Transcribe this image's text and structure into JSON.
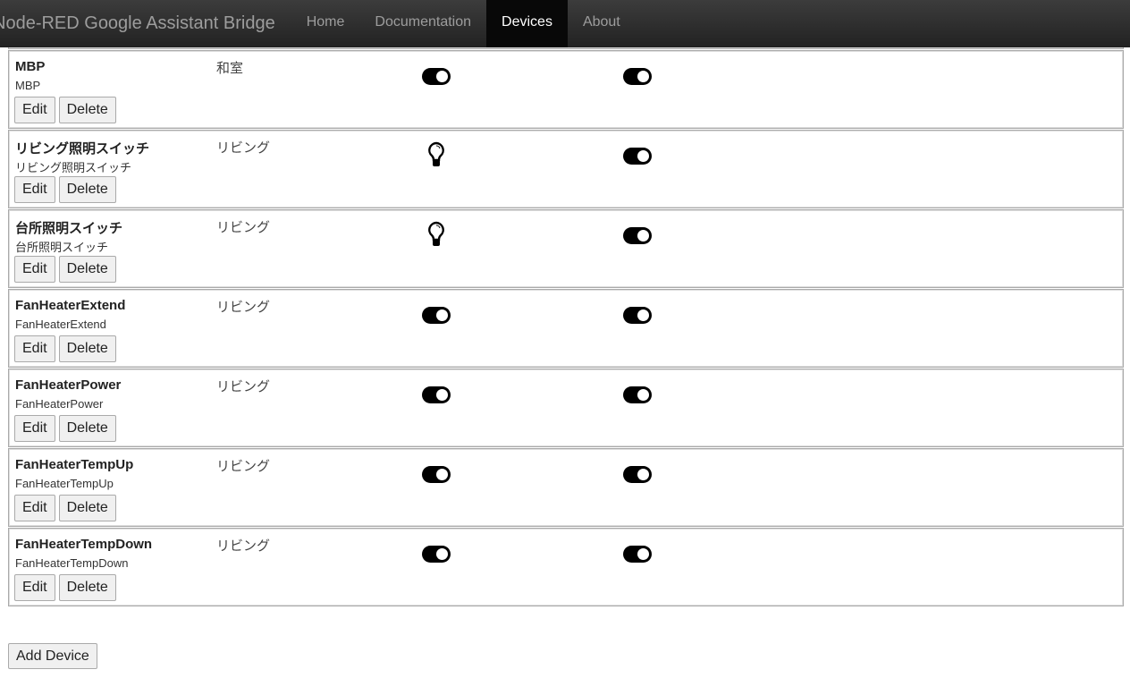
{
  "nav": {
    "brand": "Node-RED Google Assistant Bridge",
    "links": [
      "Home",
      "Documentation",
      "Devices",
      "About"
    ],
    "active": "Devices"
  },
  "buttons": {
    "edit": "Edit",
    "delete": "Delete",
    "add": "Add Device"
  },
  "devices": [
    {
      "name": "",
      "id": "",
      "room": "",
      "col1": "",
      "col2": ""
    },
    {
      "name": "MBP",
      "id": "MBP",
      "room": "和室",
      "col1": "toggle-icon",
      "col2": "toggle-icon"
    },
    {
      "name": "リビング照明スイッチ",
      "id": "リビング照明スイッチ",
      "room": "リビング",
      "col1": "lightbulb-icon",
      "col2": "toggle-icon"
    },
    {
      "name": "台所照明スイッチ",
      "id": "台所照明スイッチ",
      "room": "リビング",
      "col1": "lightbulb-icon",
      "col2": "toggle-icon"
    },
    {
      "name": "FanHeaterExtend",
      "id": "FanHeaterExtend",
      "room": "リビング",
      "col1": "toggle-icon",
      "col2": "toggle-icon"
    },
    {
      "name": "FanHeaterPower",
      "id": "FanHeaterPower",
      "room": "リビング",
      "col1": "toggle-icon",
      "col2": "toggle-icon"
    },
    {
      "name": "FanHeaterTempUp",
      "id": "FanHeaterTempUp",
      "room": "リビング",
      "col1": "toggle-icon",
      "col2": "toggle-icon"
    },
    {
      "name": "FanHeaterTempDown",
      "id": "FanHeaterTempDown",
      "room": "リビング",
      "col1": "toggle-icon",
      "col2": "toggle-icon"
    }
  ]
}
